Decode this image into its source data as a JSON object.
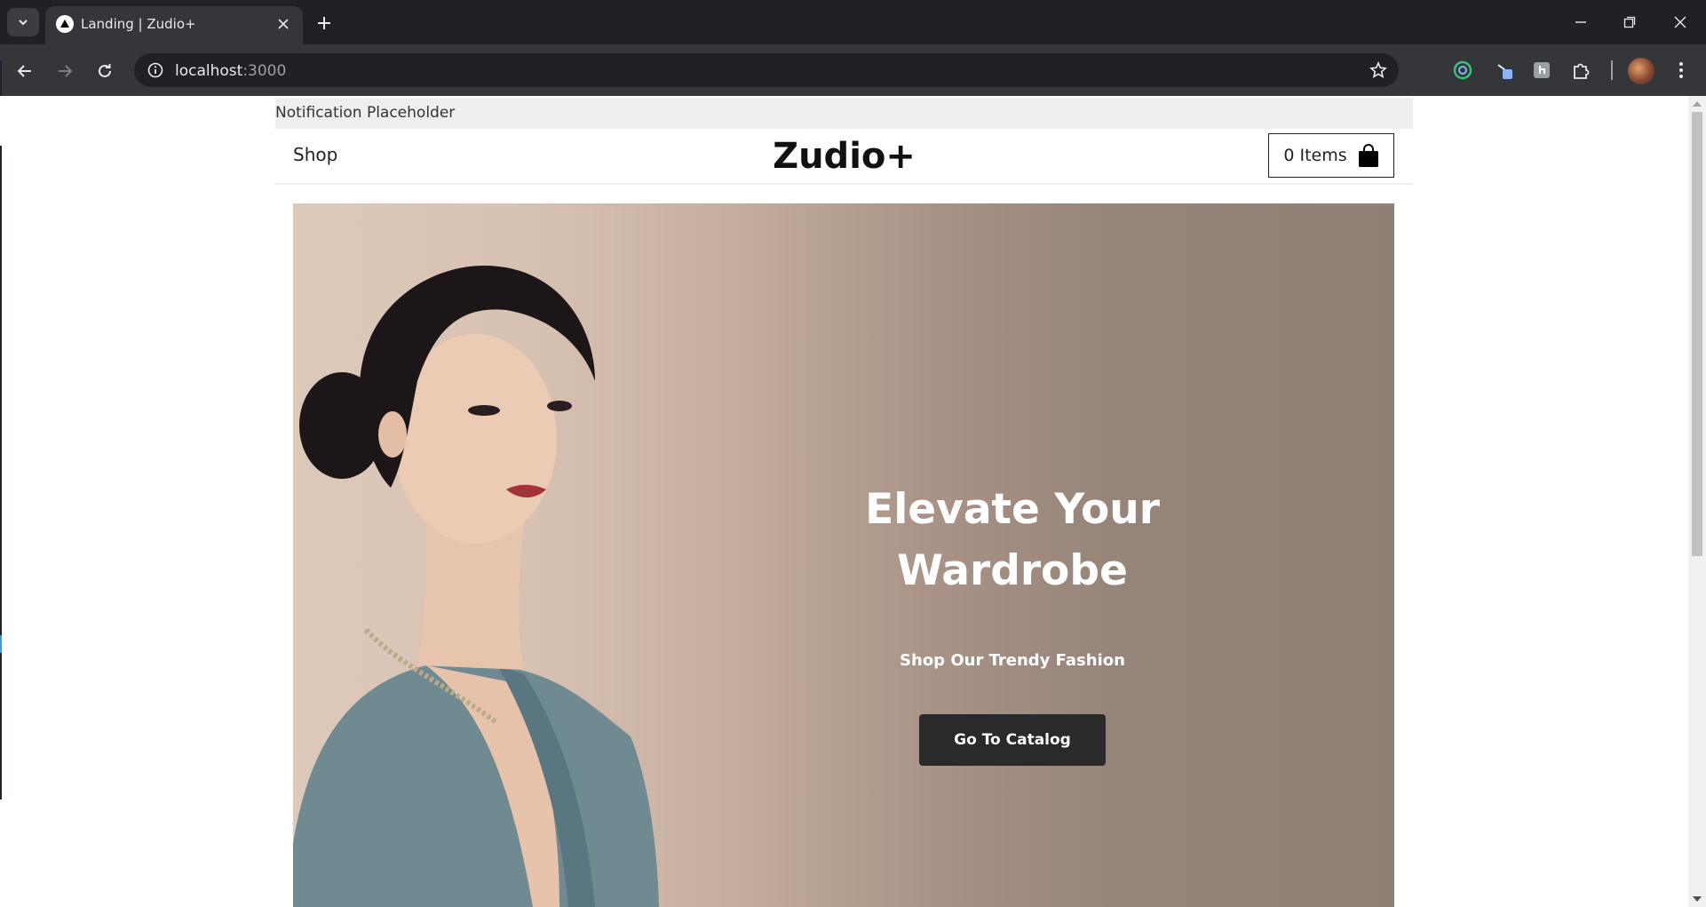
{
  "browser": {
    "tab_title": "Landing | Zudio+",
    "url_host": "localhost",
    "url_port": ":3000"
  },
  "notification": {
    "text": "Notification Placeholder"
  },
  "header": {
    "shop_label": "Shop",
    "brand": "Zudio+",
    "cart_label": "0 Items"
  },
  "hero": {
    "title_line1": "Elevate Your",
    "title_line2": "Wardrobe",
    "subtitle": "Shop Our Trendy Fashion",
    "cta_label": "Go To Catalog"
  },
  "colors": {
    "chrome_dark": "#202124",
    "chrome_toolbar": "#35363a",
    "cta_background": "#2a2a2a",
    "hero_gradient_start": "#ddc9ba",
    "hero_gradient_end": "#8f7f75"
  },
  "icons": [
    "tab-search-icon",
    "favicon-icon",
    "close-icon",
    "plus-icon",
    "minimize-icon",
    "restore-icon",
    "window-close-icon",
    "back-icon",
    "forward-icon",
    "reload-icon",
    "info-icon",
    "star-icon",
    "extension-icon",
    "menu-icon",
    "shopping-bag-icon"
  ]
}
